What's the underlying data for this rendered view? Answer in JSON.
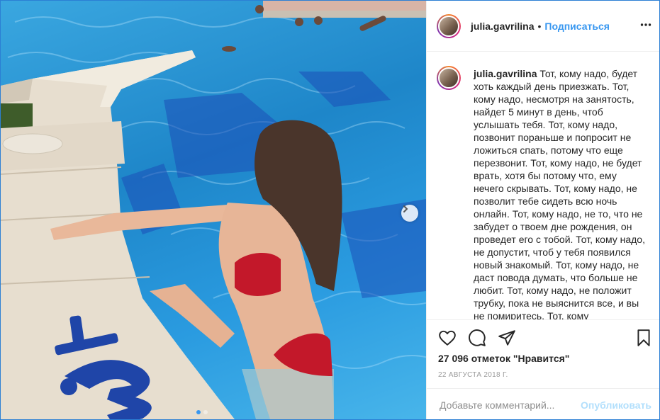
{
  "post": {
    "username": "julia.gavrilina",
    "separator": "•",
    "follow_label": "Подписаться",
    "more_icon": "more-options-icon",
    "photo_description": "swimming-pool-photo",
    "caption_body": "Тот, кому надо, будет хоть каждый день приезжать. Тот, кому надо, несмотря на занятость, найдет 5 минут в день, чтоб услышать тебя. Тот, кому надо, позвонит пораньше и попросит не ложиться спать, потому что еще перезвонит. Тот, кому надо, не будет врать, хотя бы потому что, ему нечего скрывать. Тот, кому надо, не позволит тебе сидеть всю ночь онлайн. Тот, кому надо, не то, что не забудет о твоем дне рождения, он проведет его с тобой. Тот, кому надо, не допустит, чтоб у тебя появился новый знакомый. Тот, кому надо, не даст повода думать, что больше не любит. Тот, кому надо, не положит трубку, пока не выяснится все, и вы не помиритесь. Тот, кому",
    "likes": "27 096 отметок \"Нравится\"",
    "date": "22 АВГУСТА 2018 Г.",
    "comment_placeholder": "Добавьте комментарий...",
    "publish_label": "Опубликовать",
    "pool_number": "13"
  },
  "colors": {
    "accent": "#3897f0",
    "publish_disabled": "#b2dffc",
    "pool_water": "#1e86c9",
    "pool_edge": "#e6dccb"
  }
}
